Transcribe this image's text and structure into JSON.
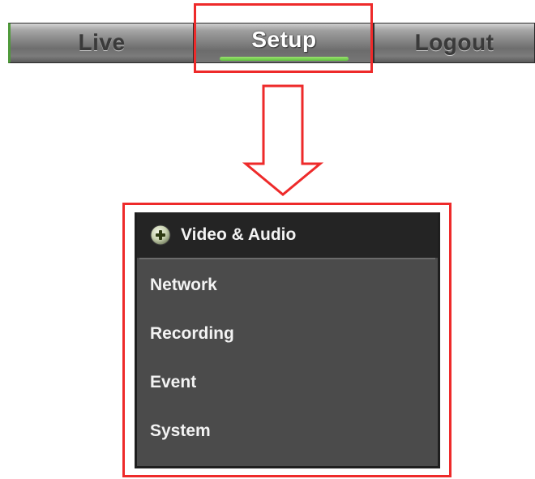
{
  "nav": {
    "tabs": [
      {
        "label": "Live"
      },
      {
        "label": "Setup"
      },
      {
        "label": "Logout"
      }
    ],
    "active_tab": "Setup"
  },
  "setup_menu": {
    "items": [
      {
        "label": "Video & Audio",
        "icon": "plus-circle-icon",
        "active": true
      },
      {
        "label": "Network"
      },
      {
        "label": "Recording"
      },
      {
        "label": "Event"
      },
      {
        "label": "System"
      }
    ]
  },
  "colors": {
    "highlight": "#ee2a2a",
    "active_underline": "#5fbf3f",
    "menu_background": "#4b4b4b",
    "menu_active_background": "#242424",
    "menu_text": "#f3f3f3"
  }
}
